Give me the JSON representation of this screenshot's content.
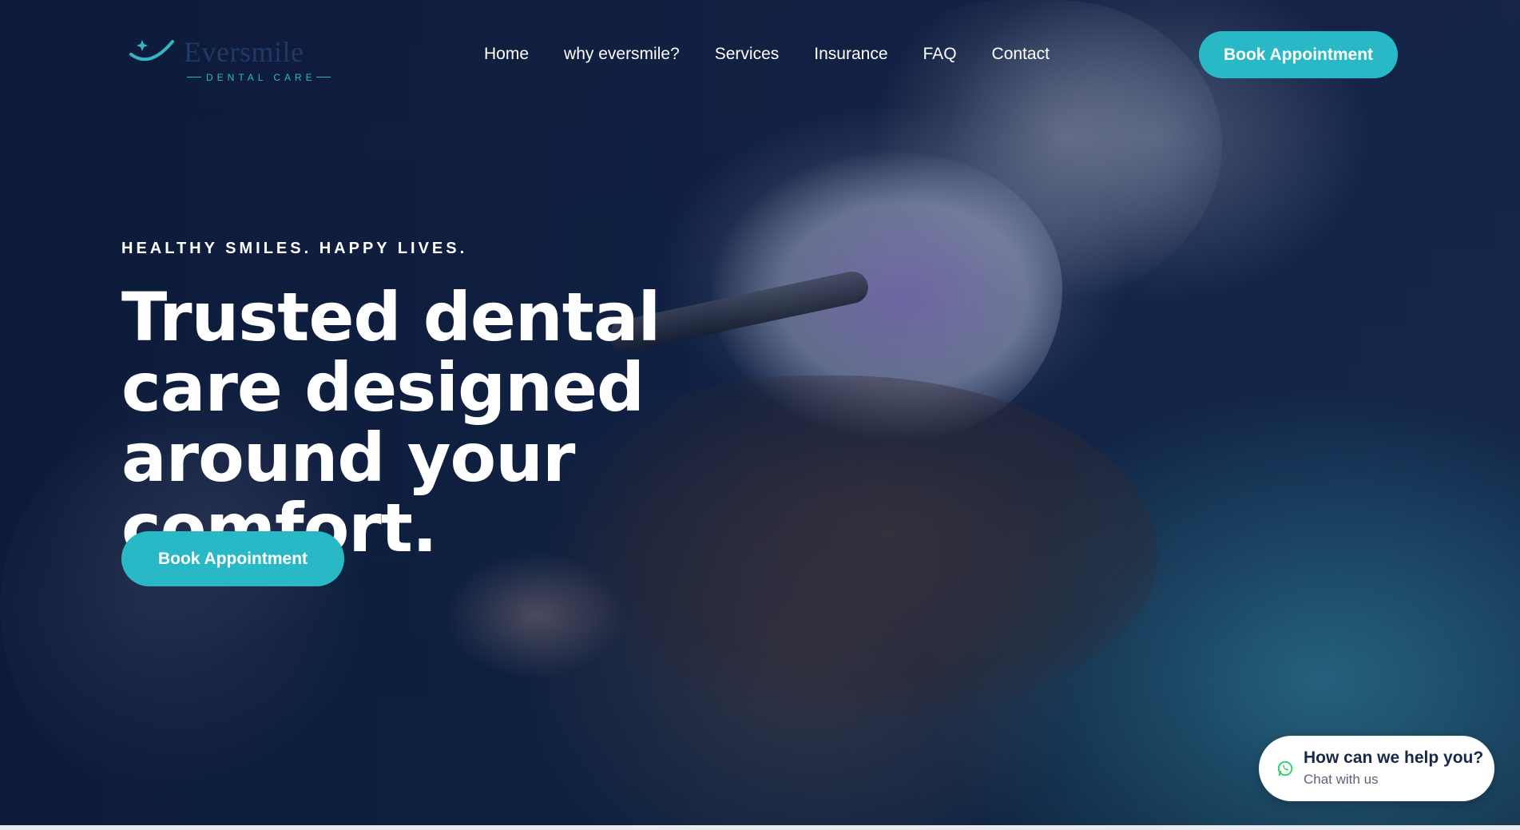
{
  "logo": {
    "name": "Eversmile",
    "subtitle": "DENTAL CARE"
  },
  "nav": {
    "items": [
      {
        "label": "Home"
      },
      {
        "label": "why eversmile?"
      },
      {
        "label": "Services"
      },
      {
        "label": "Insurance"
      },
      {
        "label": "FAQ"
      },
      {
        "label": "Contact"
      }
    ]
  },
  "header": {
    "cta_label": "Book Appointment"
  },
  "hero": {
    "tagline": "HEALTHY SMILES. HAPPY LIVES.",
    "headline": "Trusted dental care designed around your comfort.",
    "cta_label": "Book Appointment"
  },
  "chat": {
    "title": "How can we help you?",
    "subtitle": "Chat with us",
    "icon": "whatsapp-icon"
  },
  "colors": {
    "accent": "#29b9c6",
    "navy": "#0e1c38",
    "chat_title": "#17294a",
    "whatsapp": "#25d366"
  }
}
